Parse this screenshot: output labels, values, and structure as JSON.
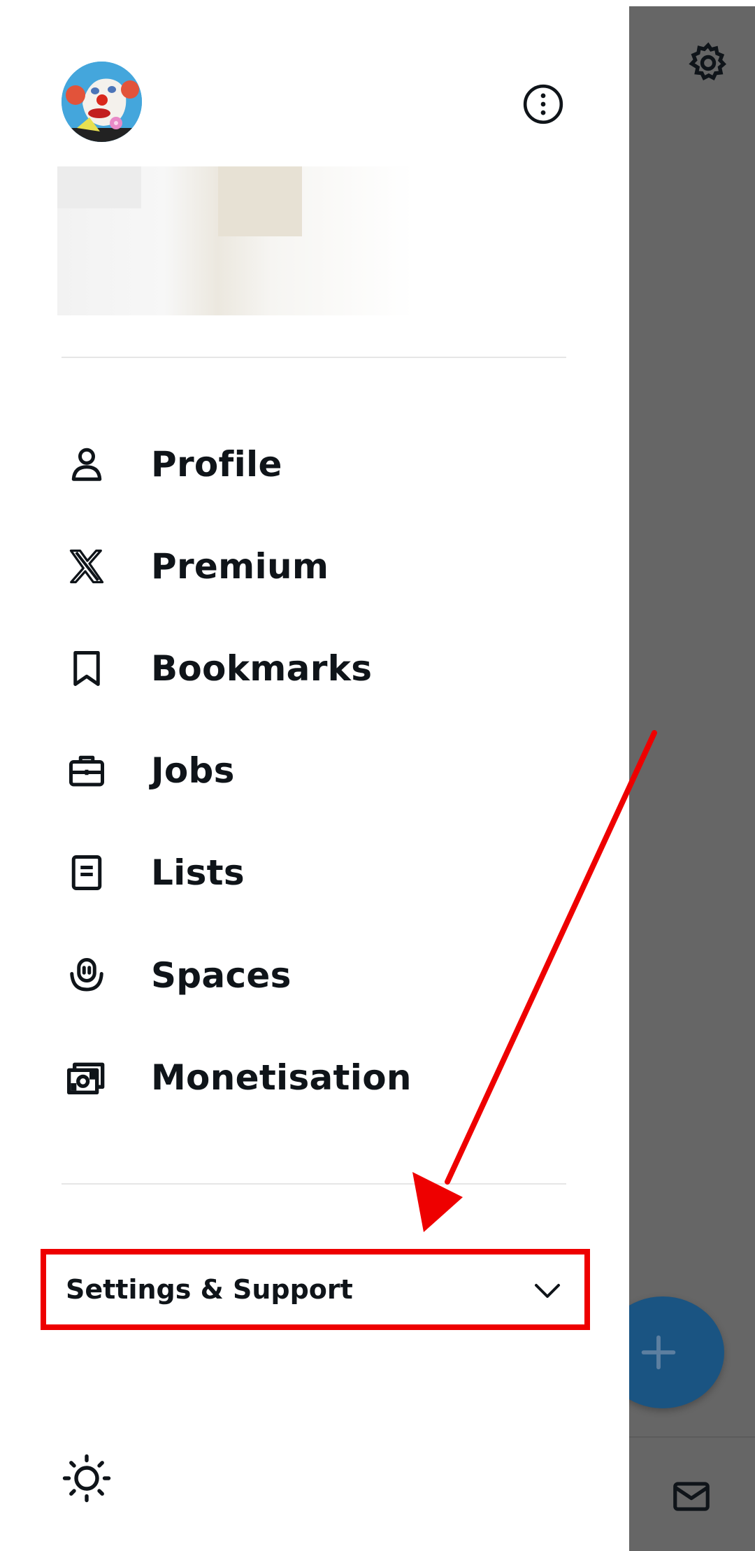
{
  "menu": {
    "items": [
      {
        "label": "Profile",
        "icon": "person-icon"
      },
      {
        "label": "Premium",
        "icon": "x-logo-icon"
      },
      {
        "label": "Bookmarks",
        "icon": "bookmark-icon"
      },
      {
        "label": "Jobs",
        "icon": "briefcase-icon"
      },
      {
        "label": "Lists",
        "icon": "list-document-icon"
      },
      {
        "label": "Spaces",
        "icon": "spaces-microphone-icon"
      },
      {
        "label": "Monetisation",
        "icon": "money-icon"
      }
    ]
  },
  "settings_support": {
    "label": "Settings & Support"
  },
  "colors": {
    "annotation": "#ee0000",
    "overlay": "#666666",
    "fab": "#1a5482",
    "text": "#0f1419"
  }
}
